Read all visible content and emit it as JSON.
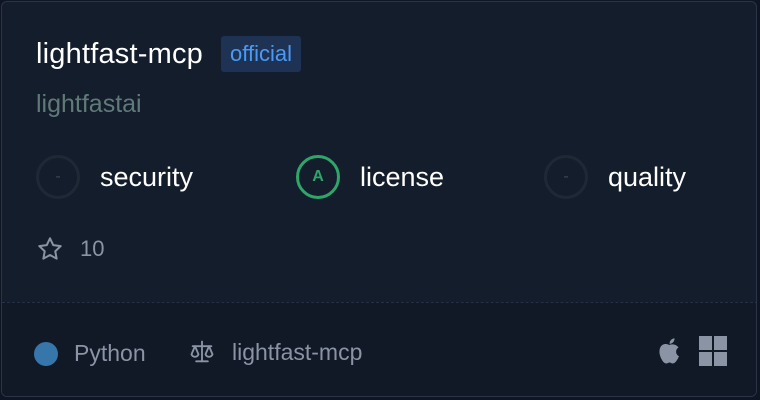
{
  "card": {
    "name": "lightfast-mcp",
    "badge": "official",
    "owner": "lightfastai",
    "scores": [
      {
        "label": "security",
        "grade": "-"
      },
      {
        "label": "license",
        "grade": "A"
      },
      {
        "label": "quality",
        "grade": "-"
      }
    ],
    "stars": "10",
    "language": "Python",
    "language_color": "#3776ab",
    "license": "lightfast-mcp",
    "platform_icons": [
      "apple-icon",
      "windows-icon"
    ]
  },
  "colors": {
    "background": "#141d2c",
    "badge_bg": "#1e3354",
    "badge_text": "#4a9af5",
    "owner_text": "#5f7a78",
    "grade_a": "#2fa56a"
  }
}
